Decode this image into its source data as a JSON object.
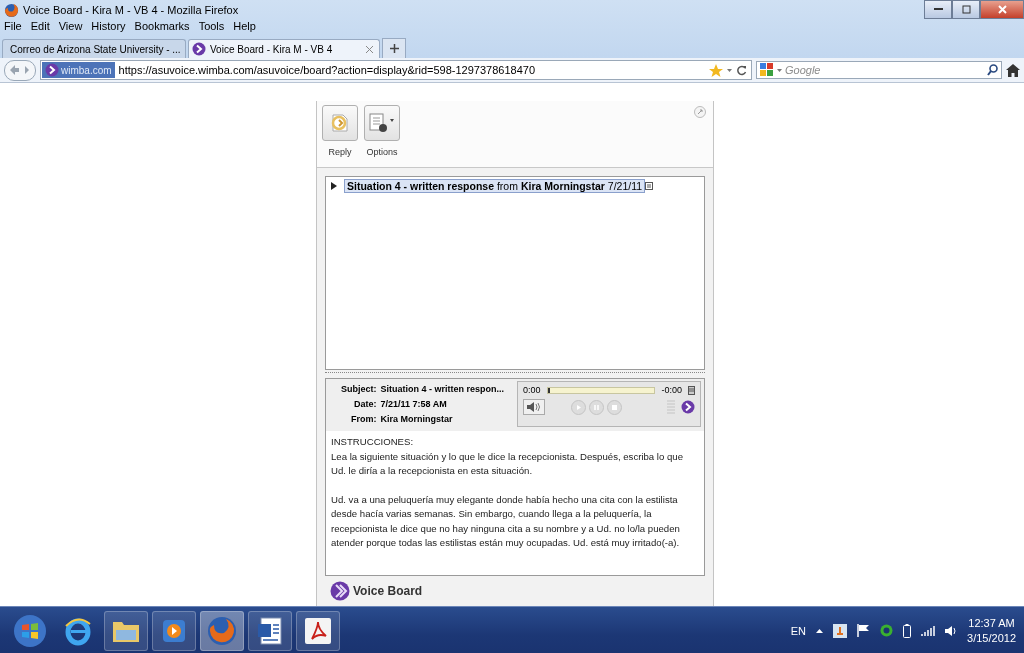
{
  "window": {
    "title": "Voice Board - Kira M - VB 4 - Mozilla Firefox"
  },
  "menu": [
    "File",
    "Edit",
    "View",
    "History",
    "Bookmarks",
    "Tools",
    "Help"
  ],
  "tabs": [
    {
      "label": "Correo de Arizona State University - ...",
      "selected": false
    },
    {
      "label": "Voice Board - Kira M - VB 4",
      "selected": true
    }
  ],
  "address": {
    "site_badge": "wimba.com",
    "url": "https://asuvoice.wimba.com/asuvoice/board?action=display&rid=598-1297378618470"
  },
  "search": {
    "placeholder": "Google"
  },
  "toolbar": [
    {
      "label": "Reply",
      "kind": "reply"
    },
    {
      "label": "Options",
      "kind": "options"
    }
  ],
  "threads": [
    {
      "text": "**Situation 4 - written response** from **Kira Morningstar** 7/21/11",
      "selected": true,
      "expanded": false
    }
  ],
  "message": {
    "fields": [
      {
        "label": "Subject:",
        "value": "Situation 4 - written respon..."
      },
      {
        "label": "Date:",
        "value": "7/21/11 7:58 AM"
      },
      {
        "label": "From:",
        "value": "Kira Morningstar"
      }
    ],
    "player": {
      "elapsed": "0:00",
      "remaining": "-0:00",
      "level": 0.02
    },
    "body": [
      "INSTRUCCIONES:\nLea la siguiente situación y lo que le dice la recepcionista.  Después, escriba lo que Ud. le diría a la recepcionista en esta situación.",
      "Ud. va a una peluquería muy elegante donde había hecho una cita con la estilista desde hacía varias semanas. Sin embargo, cuando llega a la peluquería, la recepcionista le dice que no hay ninguna cita a su nombre y a Ud. no lo/la pueden atender porque todas las estilistas están muy ocupadas.  Ud. está muy irritado(-a)."
    ]
  },
  "footer": {
    "brand": "Voice Board"
  },
  "taskbar": {
    "items": [
      {
        "kind": "start",
        "selected": false
      },
      {
        "kind": "ie",
        "selected": false
      },
      {
        "kind": "folder",
        "selected": false
      },
      {
        "kind": "media",
        "selected": false
      },
      {
        "kind": "firefox",
        "selected": true
      },
      {
        "kind": "word",
        "selected": false
      },
      {
        "kind": "acrobat",
        "selected": false
      }
    ],
    "language": "EN",
    "time": "12:37 AM",
    "date": "3/15/2012"
  }
}
